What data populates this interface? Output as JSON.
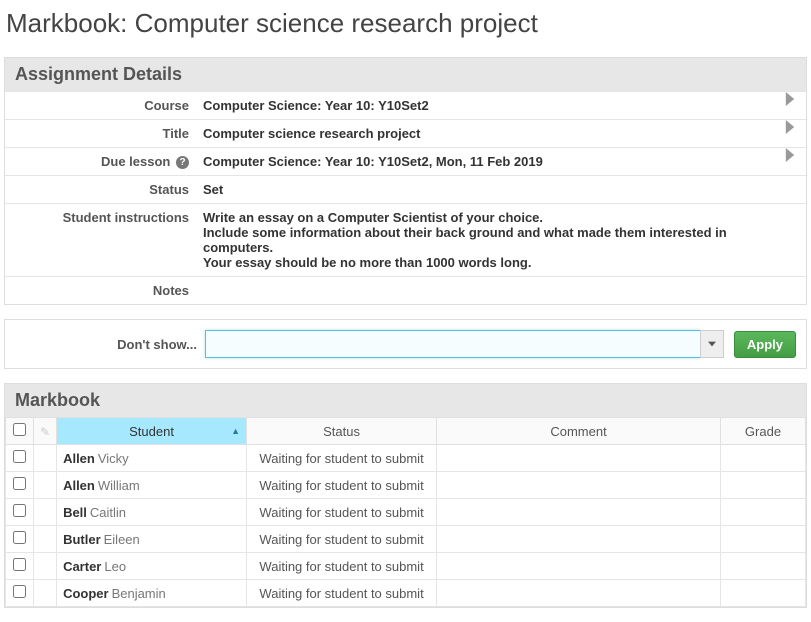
{
  "page": {
    "title_prefix": "Markbook:",
    "title_subject": "Computer science research project"
  },
  "assignment": {
    "panel_title": "Assignment Details",
    "labels": {
      "course": "Course",
      "title": "Title",
      "due": "Due lesson",
      "status": "Status",
      "instructions": "Student instructions",
      "notes": "Notes"
    },
    "course": "Computer Science: Year 10: Y10Set2",
    "title": "Computer science research project",
    "due": "Computer Science: Year 10: Y10Set2, Mon, 11 Feb 2019",
    "status": "Set",
    "instructions": "Write an essay on a Computer Scientist of your choice.\nInclude some information about their back ground and what made them interested in computers.\nYour essay should be no more than 1000 words long.",
    "notes": ""
  },
  "filter": {
    "label": "Don't show...",
    "value": "",
    "apply_label": "Apply"
  },
  "markbook": {
    "panel_title": "Markbook",
    "columns": {
      "student": "Student",
      "status": "Status",
      "comment": "Comment",
      "grade": "Grade"
    },
    "rows": [
      {
        "surname": "Allen",
        "firstname": "Vicky",
        "status": "Waiting for student to submit",
        "comment": "",
        "grade": ""
      },
      {
        "surname": "Allen",
        "firstname": "William",
        "status": "Waiting for student to submit",
        "comment": "",
        "grade": ""
      },
      {
        "surname": "Bell",
        "firstname": "Caitlin",
        "status": "Waiting for student to submit",
        "comment": "",
        "grade": ""
      },
      {
        "surname": "Butler",
        "firstname": "Eileen",
        "status": "Waiting for student to submit",
        "comment": "",
        "grade": ""
      },
      {
        "surname": "Carter",
        "firstname": "Leo",
        "status": "Waiting for student to submit",
        "comment": "",
        "grade": ""
      },
      {
        "surname": "Cooper",
        "firstname": "Benjamin",
        "status": "Waiting for student to submit",
        "comment": "",
        "grade": ""
      }
    ]
  }
}
